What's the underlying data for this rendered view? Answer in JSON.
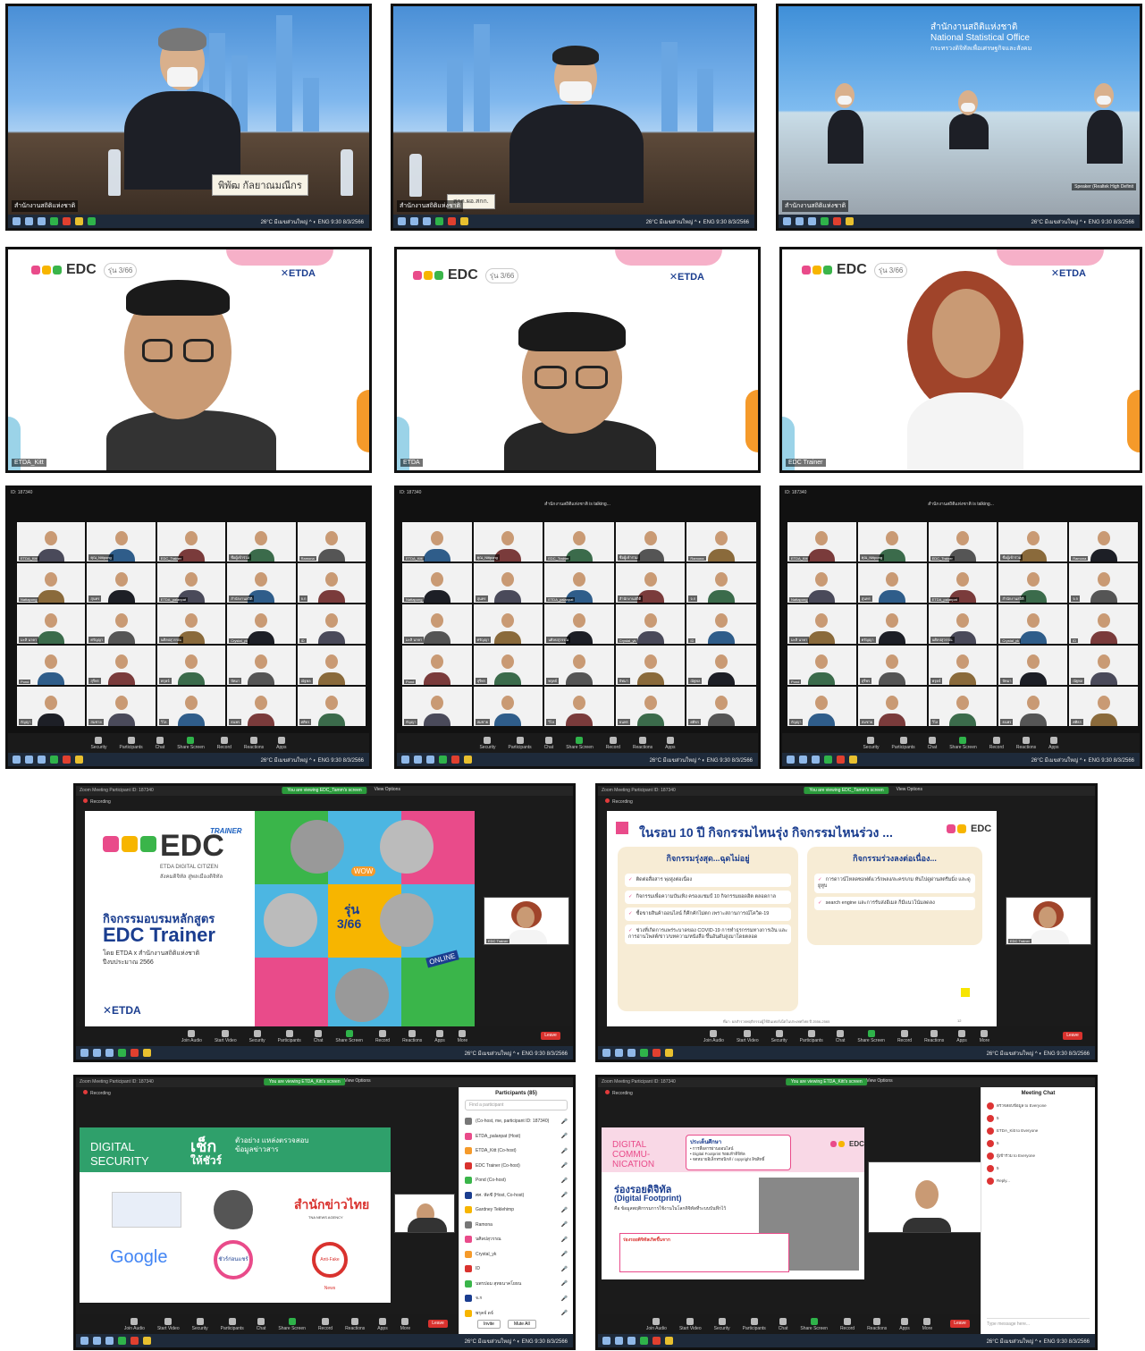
{
  "panels": {
    "room1": {
      "nameplate": "พิพัฒ  กัลยาณมณีกร",
      "name_label": "สำนักงานสถิติแห่งชาติ"
    },
    "room2": {
      "nameplate": "สกก.ผอ.สกก.",
      "name_label": "สำนักงานสถิติแห่งชาติ"
    },
    "room3": {
      "logo_line1": "สำนักงานสถิติแห่งชาติ",
      "logo_line2": "National Statistical Office",
      "logo_line3": "กระทรวงดิจิทัลเพื่อเศรษฐกิจและสังคม",
      "name_label": "สำนักงานสถิติแห่งชาติ",
      "speaker_label": "Speaker (Realtek High Definit"
    },
    "speaker1": {
      "gen_badge": "รุ่น 3/66",
      "etda": "✕ETDA",
      "name_label": "ETDA_Kitt"
    },
    "speaker2": {
      "gen_badge": "รุ่น 3/66",
      "etda": "✕ETDA",
      "name_label": "ETDA"
    },
    "speaker3": {
      "gen_badge": "รุ่น 3/66",
      "etda": "✕ETDA",
      "name_label": "EDC Trainer"
    },
    "gallery1": {
      "meeting_id": "ID: 187340"
    },
    "gallery2": {
      "meeting_id": "ID: 187340",
      "talking": "สำนักงานสถิติแห่งชาติ is talking..."
    },
    "gallery3": {
      "meeting_id": "ID: 187340",
      "talking": "สำนักงานสถิติแห่งชาติ is talking..."
    },
    "share1": {
      "window_title": "Zoom Meeting Participant ID: 187340",
      "viewing": "You are viewing EDC_Tamm's screen",
      "view_options": "View Options",
      "recording": "Recording",
      "brand": "EDC",
      "brand_tag": "TRAINER",
      "brand_sub": "ETDA DIGITAL CITIZEN",
      "brand_thai": "สังคมดิจิทัล สู่พลเมืองดิจิทัล",
      "course_title": "กิจกรรมอบรมหลักสูตร",
      "course_name": "EDC Trainer",
      "course_by": "โดย ETDA x สำนักงานสถิติแห่งชาติ",
      "course_year": "ปีงบประมาณ 2566",
      "gen_label": "รุ่น",
      "gen_value": "3/66",
      "etda": "✕ETDA",
      "online": "ONLINE",
      "wow": "WOW",
      "thumb_name": "EDC Trainer",
      "leave": "Leave"
    },
    "share2": {
      "window_title": "Zoom Meeting Participant ID: 187340",
      "viewing": "You are viewing EDC_Tamm's screen",
      "view_options": "View Options",
      "recording": "Recording",
      "slide_title": "ในรอบ 10 ปี กิจกรรมไหนรุ่ง กิจกรรมไหนร่วง ...",
      "left_head": "กิจกรรมรุ่งสุด...ฉุดไม่อยู่",
      "left_items": [
        "ติดต่อสื่อสาร พุ่งสูงต่อเนื่อง",
        "กิจกรรมเพื่อความบันเทิง ครองแชมป์ 10 กิจกรรมยอดฮิต ตลอดกาล",
        "ซื้อขายสินค้าออนไลน์ ก็คึกคักไม่ตก เพราะสถานการณ์โควิด-19",
        "ช่วงที่เกิดการแพร่ระบาดของ COVID-19 การทำธุรกรรมทางการเงิน และการอ่านโพสต์/ข่าว/บทความ/หนังสือ ขึ้นอันดับสูงมาโดยตลอด"
      ],
      "right_head": "กิจกรรมร่วงลงต่อเนื่อง...",
      "right_items": [
        "การดาวน์โหลดซอฟต์แวร์/เพลง/ละคร/เกม หันไปดูผ่านสตรีมมิ่ง และดูยูทูบ",
        "search engine และการรับส่งอีเมล ก็มีแนวโน้มลดลง"
      ],
      "source": "ที่มา: ผลสำรวจพฤติกรรมผู้ใช้อินเทอร์เน็ตในประเทศไทย ปี 2556-2565",
      "page": "12",
      "thumb_name": "EDC Trainer",
      "leave": "Leave"
    },
    "share3": {
      "window_title": "Zoom Meeting Participant ID: 187340",
      "viewing": "You are viewing ETDA_Kitt's screen",
      "view_options": "View Options",
      "recording": "Recording",
      "ds_title1": "DIGITAL",
      "ds_title2": "SECURITY",
      "check_title": "เช็ก",
      "check_sub": "ให้ชัวร์",
      "check_desc": "ตัวอย่าง แหล่งตรวจสอบ ข้อมูลข่าวสาร",
      "logos": [
        "Google",
        "ชัวร์ก่อนแชร์",
        "สำนักข่าวไทย",
        "Anti-Fake News"
      ],
      "tna": "TNA NEWS AGENCY",
      "participants_title": "Participants (85)",
      "participants_search": "Find a participant",
      "participants": [
        "(Co-host, me, participant ID: 187340)",
        "ETDA_palanpat (Host)",
        "ETDA_Kitt (Co-host)",
        "EDC Trainer (Co-host)",
        "Pond (Co-host)",
        "ศศ. หัดชี (Host, Co-host)",
        "Gardney Teklehimp",
        "Ramona",
        "นศิลปสุวรรณ",
        "Crystal_yk",
        "ID",
        "นพรปอม สุทธนาคโยธน",
        "จ.ก",
        "พรุคจ์ ดจ์"
      ],
      "invite": "Invite",
      "mute_all": "Mute All",
      "leave": "Leave"
    },
    "share4": {
      "window_title": "Zoom Meeting Participant ID: 187340",
      "viewing": "You are viewing ETDA_Kitt's screen",
      "view_options": "View Options",
      "recording": "Recording",
      "dc_title": "DIGITAL COMMU- NICATION",
      "issue_head": "ประเด็นศึกษา",
      "issue_items": [
        "• การสื่อสารผ่านออนไลน์",
        "• Digital Footprint รอยเท้าดิจิทัล",
        "• จดหมายอิเล็กทรอนิกส์ / copyright ลิขสิทธิ์"
      ],
      "fp_title": "ร่องรอยดิจิทัล",
      "fp_en": "(Digital Footprint)",
      "fp_desc": "คือ ข้อมูลพฤติกรรมการใช้งานในโลกดิจิทัลที่ระบบบันทึกไว้",
      "fp_box_head": "ร่องรอยดิจิทัลเกิดขึ้นจาก",
      "chat_title": "Meeting Chat",
      "chat_rows": [
        "ตรวจสอบข้อมูล to Everyone",
        "5",
        "ETDA_Kitt to Everyone",
        "5",
        "ผู้เข้าร่วม to Everyone",
        "5",
        "Reply..."
      ],
      "chat_input": "Type message here...",
      "leave": "Leave"
    }
  },
  "zoom_controls": [
    "Security",
    "Participants",
    "Chat",
    "Share Screen",
    "Record",
    "Reactions",
    "Apps"
  ],
  "zoom_controls_full": [
    "Join Audio",
    "Start Video",
    "Security",
    "Participants",
    "Chat",
    "Share Screen",
    "Record",
    "Reactions",
    "Apps",
    "More"
  ],
  "taskbar_tray": "26°C มีเมฆส่วนใหญ่  ^  ◐ ENG  9:30 8/3/2566",
  "gallery_names": [
    "ETDA_Kitt",
    "คุณ_Nitipong",
    "EDC_Trainer",
    "ชื่อผู้เข้าร่วม",
    "Ramona",
    "Nattapong",
    "สุนทร",
    "ETDA_palanpat",
    "สำนักงานสถิติ",
    "จ.ก",
    "มะลิ นาคา",
    "ศรัญญา",
    "นศิลปสุวรรณ",
    "Crystal_yk",
    "ID",
    "Pond",
    "สุรีพร",
    "พรุคจ์",
    "ปัทมา",
    "ณัฐพล",
    "กัญญา",
    "สมชาย",
    "วิไล",
    "ธนพร",
    "ศศิธร"
  ],
  "colors": {
    "zoom_green": "#2b9b3c",
    "leave_red": "#d9322e",
    "edc_pink": "#e94b8a",
    "edc_yellow": "#f7b500",
    "edc_green": "#3ab54a",
    "etda_blue": "#1a3d8f"
  }
}
